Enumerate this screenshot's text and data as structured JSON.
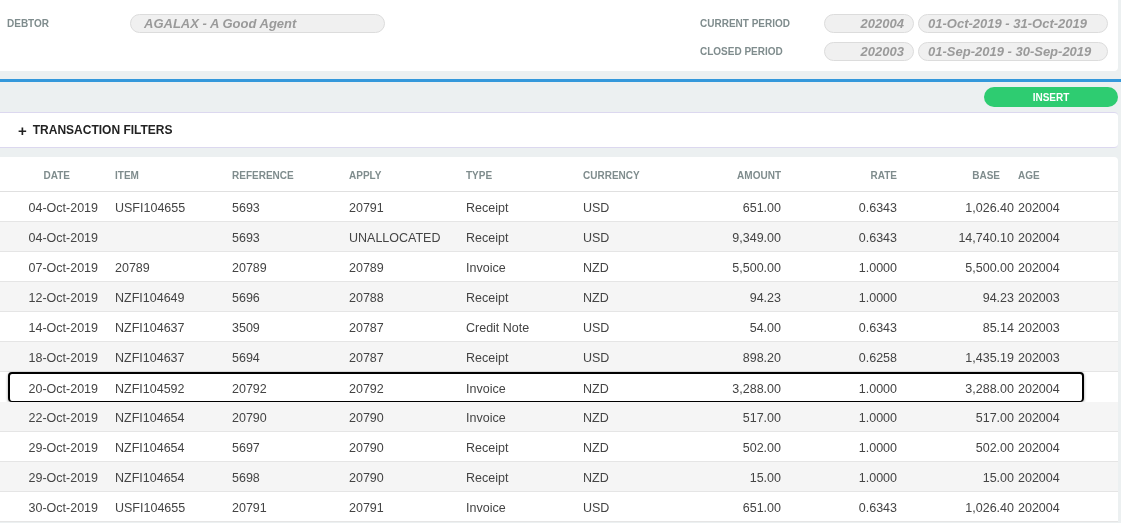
{
  "header": {
    "debtor": {
      "label": "DEBTOR",
      "value": "AGALAX - A Good Agent"
    },
    "periods": [
      {
        "label": "CURRENT PERIOD",
        "code": "202004",
        "range": "01-Oct-2019 - 31-Oct-2019"
      },
      {
        "label": "CLOSED PERIOD",
        "code": "202003",
        "range": "01-Sep-2019 - 30-Sep-2019"
      }
    ]
  },
  "insert_button": "INSERT",
  "filters": {
    "icon": "+",
    "label": "TRANSACTION FILTERS"
  },
  "table": {
    "columns": [
      "DATE",
      "ITEM",
      "REFERENCE",
      "APPLY",
      "TYPE",
      "CURRENCY",
      "AMOUNT",
      "RATE",
      "BASE",
      "AGE"
    ],
    "rows": [
      {
        "cells": [
          "04-Oct-2019",
          "USFI104655",
          "5693",
          "20791",
          "Receipt",
          "USD",
          "651.00",
          "0.6343",
          "1,026.40",
          "202004"
        ],
        "selected": false
      },
      {
        "cells": [
          "04-Oct-2019",
          "",
          "5693",
          "UNALLOCATED",
          "Receipt",
          "USD",
          "9,349.00",
          "0.6343",
          "14,740.10",
          "202004"
        ],
        "selected": false
      },
      {
        "cells": [
          "07-Oct-2019",
          "20789",
          "20789",
          "20789",
          "Invoice",
          "NZD",
          "5,500.00",
          "1.0000",
          "5,500.00",
          "202004"
        ],
        "selected": false
      },
      {
        "cells": [
          "12-Oct-2019",
          "NZFI104649",
          "5696",
          "20788",
          "Receipt",
          "NZD",
          "94.23",
          "1.0000",
          "94.23",
          "202003"
        ],
        "selected": false
      },
      {
        "cells": [
          "14-Oct-2019",
          "NZFI104637",
          "3509",
          "20787",
          "Credit Note",
          "USD",
          "54.00",
          "0.6343",
          "85.14",
          "202003"
        ],
        "selected": false
      },
      {
        "cells": [
          "18-Oct-2019",
          "NZFI104637",
          "5694",
          "20787",
          "Receipt",
          "USD",
          "898.20",
          "0.6258",
          "1,435.19",
          "202003"
        ],
        "selected": false
      },
      {
        "cells": [
          "20-Oct-2019",
          "NZFI104592",
          "20792",
          "20792",
          "Invoice",
          "NZD",
          "3,288.00",
          "1.0000",
          "3,288.00",
          "202004"
        ],
        "selected": true
      },
      {
        "cells": [
          "22-Oct-2019",
          "NZFI104654",
          "20790",
          "20790",
          "Invoice",
          "NZD",
          "517.00",
          "1.0000",
          "517.00",
          "202004"
        ],
        "selected": false
      },
      {
        "cells": [
          "29-Oct-2019",
          "NZFI104654",
          "5697",
          "20790",
          "Receipt",
          "NZD",
          "502.00",
          "1.0000",
          "502.00",
          "202004"
        ],
        "selected": false
      },
      {
        "cells": [
          "29-Oct-2019",
          "NZFI104654",
          "5698",
          "20790",
          "Receipt",
          "NZD",
          "15.00",
          "1.0000",
          "15.00",
          "202004"
        ],
        "selected": false
      },
      {
        "cells": [
          "30-Oct-2019",
          "USFI104655",
          "20791",
          "20791",
          "Invoice",
          "USD",
          "651.00",
          "0.6343",
          "1,026.40",
          "202004"
        ],
        "selected": false
      }
    ]
  }
}
